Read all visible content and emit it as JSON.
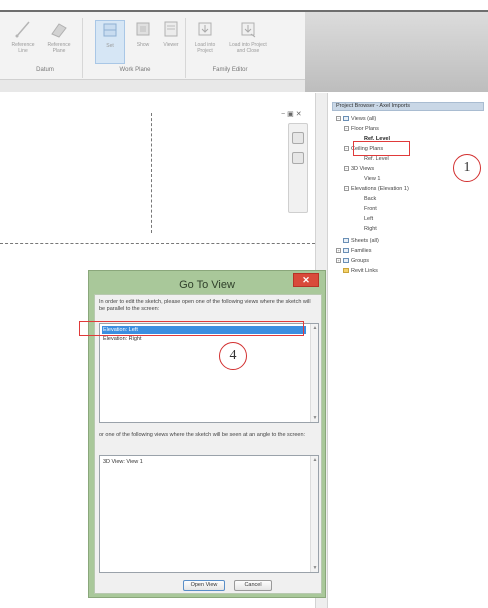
{
  "ribbon": {
    "tools": [
      {
        "label": "Reference Line",
        "icon": "reference-line-icon"
      },
      {
        "label": "Reference Plane",
        "icon": "reference-plane-icon"
      },
      {
        "label": "Set",
        "icon": "set-workplane-icon"
      },
      {
        "label": "Show",
        "icon": "show-workplane-icon"
      },
      {
        "label": "Viewer",
        "icon": "viewer-icon"
      },
      {
        "label": "Load into Project",
        "icon": "load-into-project-icon"
      },
      {
        "label": "Load into Project and Close",
        "icon": "load-into-project-close-icon"
      }
    ],
    "panels": [
      "Datum",
      "Work Plane",
      "Family Editor"
    ]
  },
  "project_browser": {
    "title": "Project Browser - Axel Imports",
    "items": [
      {
        "label": "Views (all)",
        "level": 0,
        "expander": "−"
      },
      {
        "label": "Floor Plans",
        "level": 1,
        "expander": "−"
      },
      {
        "label": "Ref. Level",
        "level": 2,
        "bold": true
      },
      {
        "label": "Ceiling Plans",
        "level": 1,
        "expander": "−"
      },
      {
        "label": "Ref. Level",
        "level": 2
      },
      {
        "label": "3D Views",
        "level": 1,
        "expander": "−"
      },
      {
        "label": "View 1",
        "level": 2
      },
      {
        "label": "Elevations (Elevation 1)",
        "level": 1,
        "expander": "−"
      },
      {
        "label": "Back",
        "level": 2
      },
      {
        "label": "Front",
        "level": 2
      },
      {
        "label": "Left",
        "level": 2
      },
      {
        "label": "Right",
        "level": 2
      },
      {
        "label": "Sheets (all)",
        "level": 0
      },
      {
        "label": "Families",
        "level": 0,
        "expander": "+"
      },
      {
        "label": "Groups",
        "level": 0,
        "expander": "+"
      },
      {
        "label": "Revit Links",
        "level": 0,
        "link": true
      }
    ]
  },
  "callouts": {
    "one": "1",
    "four": "4"
  },
  "dialog": {
    "title": "Go To View",
    "close_glyph": "✕",
    "instruction1": "In order to edit the sketch, please open one of the following views where the sketch will be parallel to the screen:",
    "list1": [
      "Elevation: Left",
      "Elevation: Right"
    ],
    "instruction2": "or one of the following views where the sketch will be seen at an angle to the screen:",
    "list2": [
      "3D View: View 1"
    ],
    "open_button": "Open View",
    "cancel_button": "Cancel"
  },
  "colors": {
    "dialog_frame": "#a9c89a",
    "selection": "#3b8ee0",
    "callout_red": "#e03a3a",
    "close_button": "#d94b3b"
  }
}
